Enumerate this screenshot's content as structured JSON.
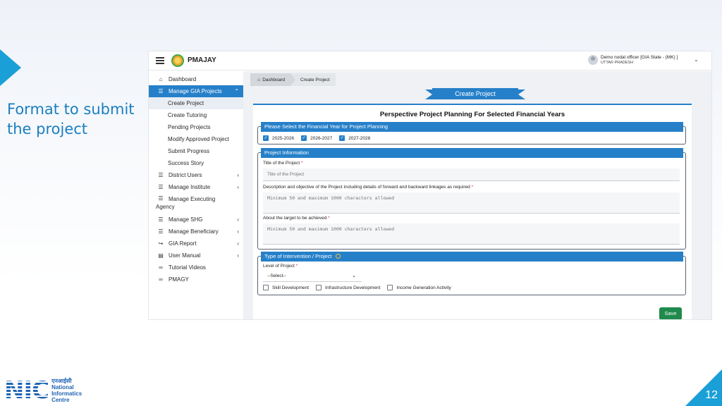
{
  "slide": {
    "caption": "Format to submit the project",
    "page_number": "12",
    "logo": {
      "hindi": "एनआईसी",
      "line1": "National",
      "line2": "Informatics",
      "line3": "Centre",
      "mark": "NIC"
    },
    "accent_color": "#1a9fd6"
  },
  "app": {
    "brand": "PMAJAY",
    "user": {
      "name": "Demo nodal officer [GIA State - (MK) ]",
      "state": "UTTAR PRADESH"
    },
    "sidebar": {
      "items": [
        {
          "label": "Dashboard",
          "icon": "home-icon"
        },
        {
          "label": "Manage GIA Projects",
          "icon": "list-icon",
          "active": true
        },
        {
          "label": "District Users",
          "icon": "list-icon"
        },
        {
          "label": "Manage Institute",
          "icon": "list-icon"
        },
        {
          "label": "Manage Executing",
          "label2": "Agency",
          "icon": "list-icon"
        },
        {
          "label": "Manage SHG",
          "icon": "list-icon"
        },
        {
          "label": "Manage Beneficiary",
          "icon": "list-icon"
        },
        {
          "label": "GIA Report",
          "icon": "login-icon"
        },
        {
          "label": "User Manual",
          "icon": "document-icon"
        },
        {
          "label": "Tutorial Videos",
          "icon": "link-icon"
        },
        {
          "label": "PMAGY",
          "icon": "link-icon"
        }
      ],
      "subitems": [
        "Create Project",
        "Create Tutoring",
        "Pending Projects",
        "Modify Approved Project",
        "Submit Progress",
        "Success Story"
      ]
    },
    "breadcrumb": {
      "home": "Dashboard",
      "current": "Create Project"
    },
    "page_ribbon": "Create Project",
    "form": {
      "title": "Perspective Project Planning For Selected Financial Years",
      "fy_section": {
        "heading": "Please Select the Financial Year for Project Planning",
        "years": [
          "2025-2026",
          "2026-2027",
          "2027-2028"
        ]
      },
      "info_section": {
        "heading": "Project Information",
        "title_label": "Title of the Project",
        "title_placeholder": "Title of the Project",
        "desc_label": "Description and objective of the Project including details of forward and backward linkages as required",
        "desc_placeholder": "Minimum 50 and maximum 1000 characters allowed",
        "target_label": "About the target to be achieved",
        "target_placeholder": "Minimum 50 and maximum 1000 characters allowed",
        "required_mark": "*"
      },
      "intervention_section": {
        "heading": "Type of Intervention / Project",
        "level_label": "Level of Project",
        "level_value": "--Select--",
        "types": [
          "Skill Development",
          "Infrastructure Development",
          "Income Generation Activity"
        ]
      },
      "save_label": "Save",
      "primary_color": "#2680c9",
      "save_color": "#1f8a4c"
    }
  }
}
